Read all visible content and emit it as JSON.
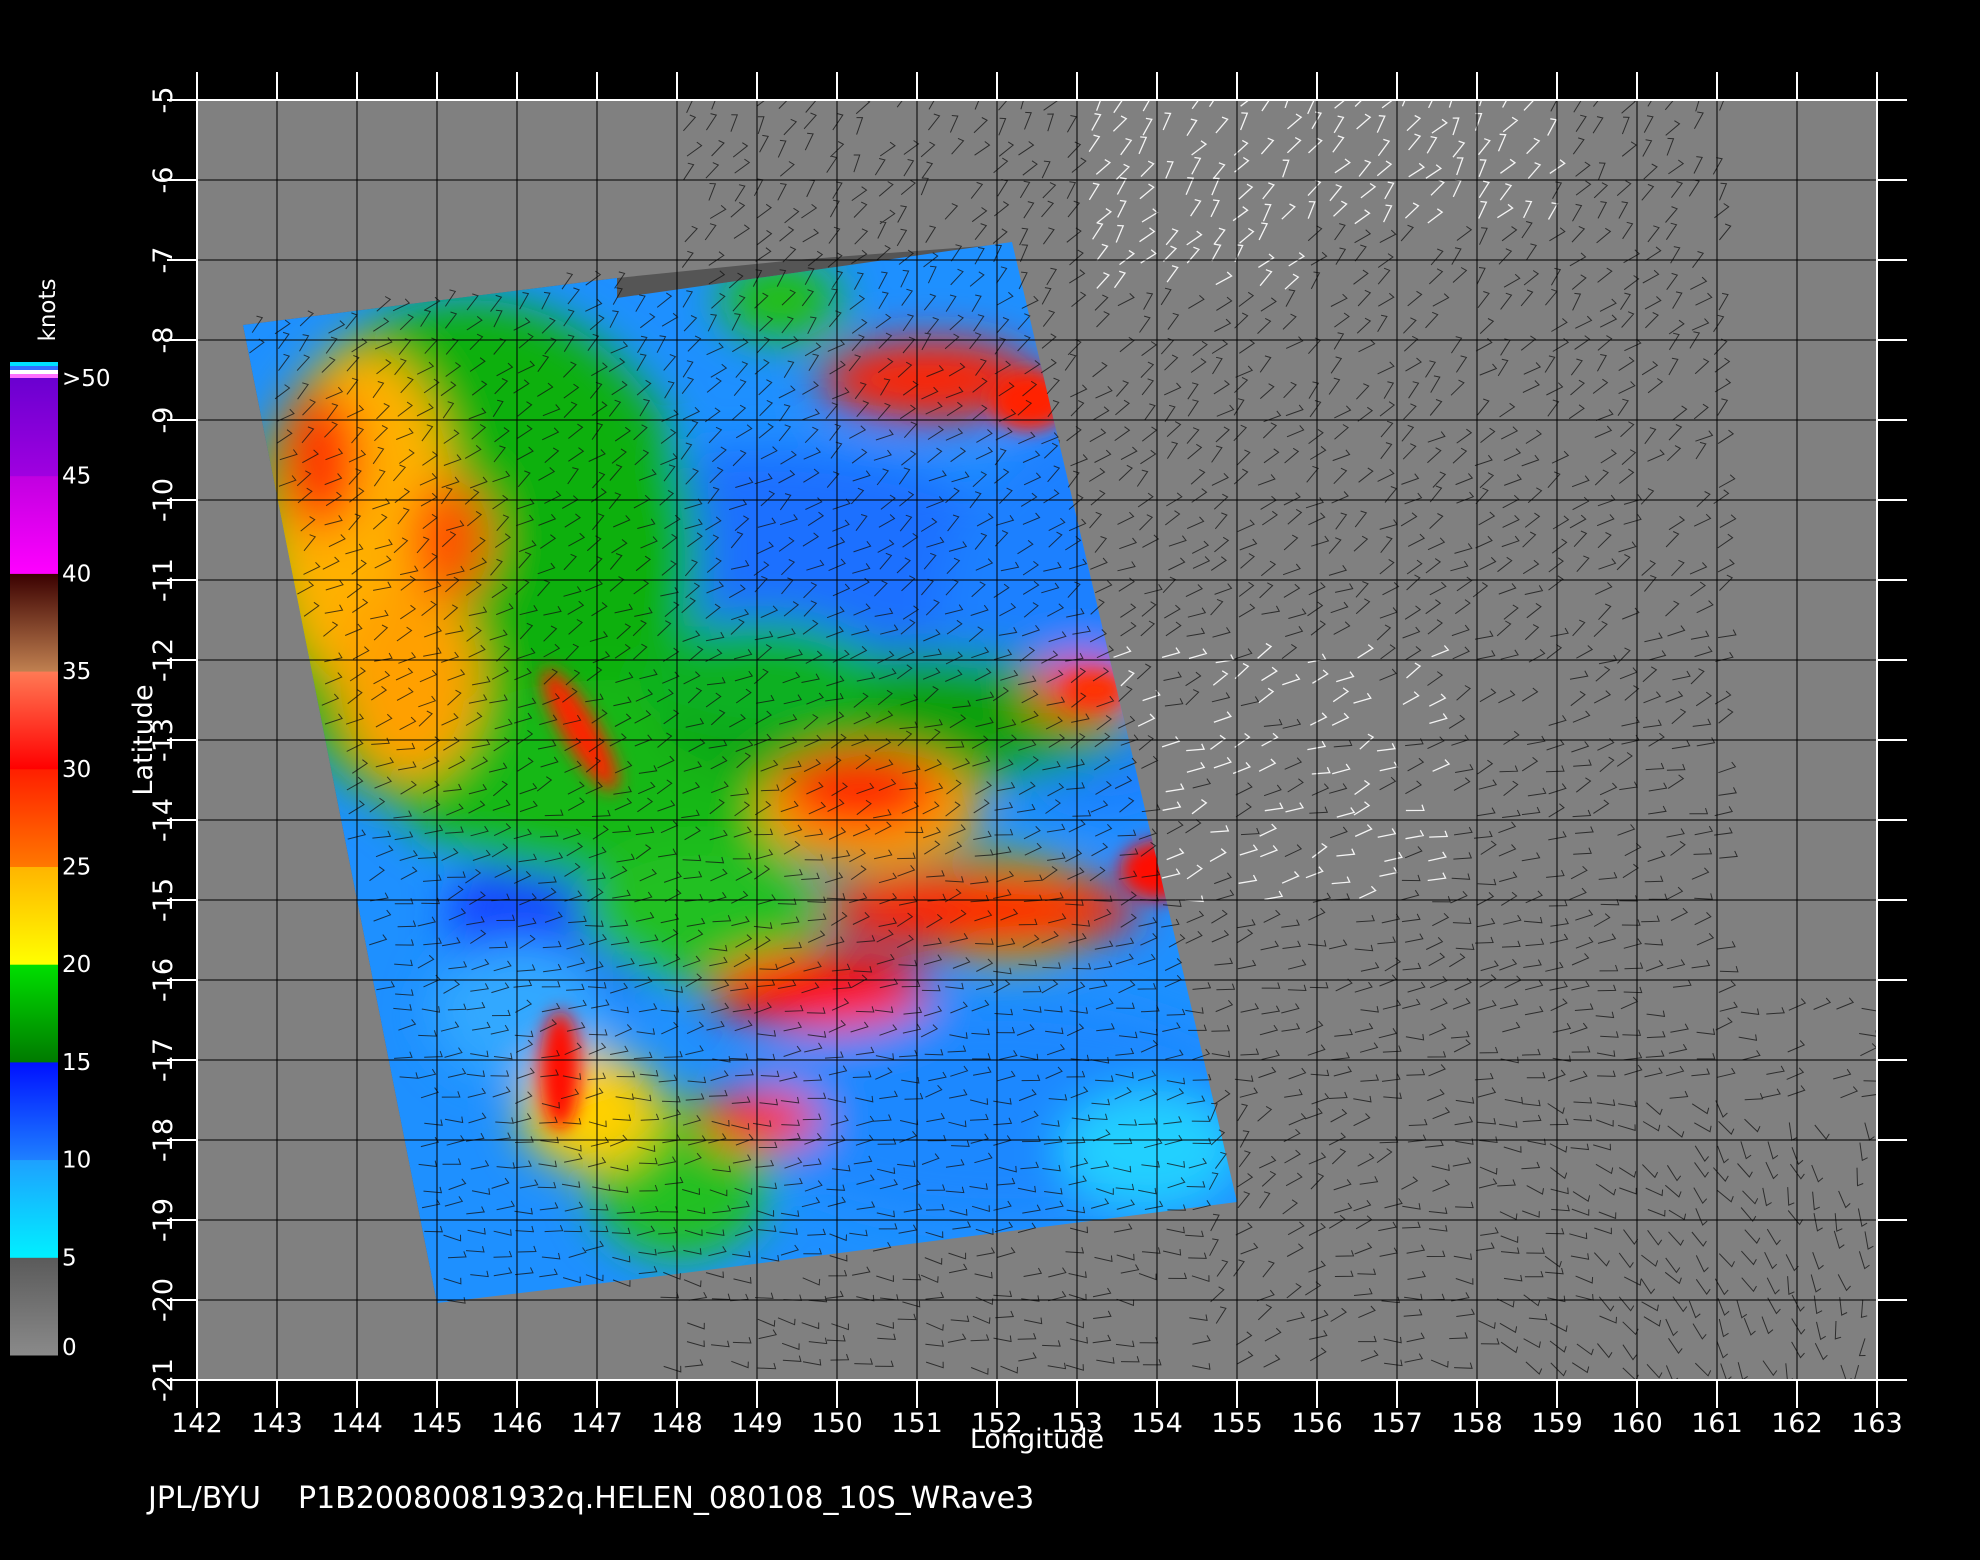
{
  "colors": {
    "background": "#000000",
    "frame_background": "#808080",
    "off_swath": "#555555",
    "grid": "#000000",
    "text": "#ffffff"
  },
  "axes": {
    "xlabel": "Longitude",
    "ylabel": "Latitude",
    "xlim": [
      142,
      163
    ],
    "ylim": [
      -21,
      -5
    ],
    "x_ticks": [
      "142",
      "143",
      "144",
      "145",
      "146",
      "147",
      "148",
      "149",
      "150",
      "151",
      "152",
      "153",
      "154",
      "155",
      "156",
      "157",
      "158",
      "159",
      "160",
      "161",
      "162",
      "163"
    ],
    "y_ticks": [
      "-5",
      "-6",
      "-7",
      "-8",
      "-9",
      "-10",
      "-11",
      "-12",
      "-13",
      "-14",
      "-15",
      "-16",
      "-17",
      "-18",
      "-19",
      "-20",
      "-21"
    ]
  },
  "colorbar": {
    "unit": "knots",
    "labels": [
      ">50",
      "45",
      "40",
      "35",
      "30",
      "25",
      "20",
      "15",
      "10",
      "5",
      "0"
    ],
    "values": [
      50,
      45,
      40,
      35,
      30,
      25,
      20,
      15,
      10,
      5,
      0
    ],
    "bands": [
      {
        "from": 0,
        "to": 5,
        "top": "#5a5a5a",
        "bottom": "#8a8a8a"
      },
      {
        "from": 5,
        "to": 10,
        "top": "#1ea0ff",
        "bottom": "#00f0ff"
      },
      {
        "from": 10,
        "to": 15,
        "top": "#0010ff",
        "bottom": "#1e80ff"
      },
      {
        "from": 15,
        "to": 20,
        "top": "#00e000",
        "bottom": "#007a00"
      },
      {
        "from": 20,
        "to": 25,
        "top": "#ffb400",
        "bottom": "#ffff00"
      },
      {
        "from": 25,
        "to": 30,
        "top": "#ff1e00",
        "bottom": "#ff7800"
      },
      {
        "from": 30,
        "to": 35,
        "top": "#ff7a55",
        "bottom": "#ff0000"
      },
      {
        "from": 35,
        "to": 40,
        "top": "#3a0000",
        "bottom": "#c08050"
      },
      {
        "from": 40,
        "to": 45,
        "top": "#c000e0",
        "bottom": "#ff00ff"
      },
      {
        "from": 45,
        "to": 50,
        "top": "#6a00d0",
        "bottom": "#a000e0"
      }
    ],
    "over_colors": [
      "#00e0ff",
      "#3070ff",
      "#ffffff",
      "#ff70ff"
    ]
  },
  "footer": {
    "source": "JPL/BYU",
    "filename": "P1B20080081932q.HELEN_080108_10S_WRave3"
  }
}
